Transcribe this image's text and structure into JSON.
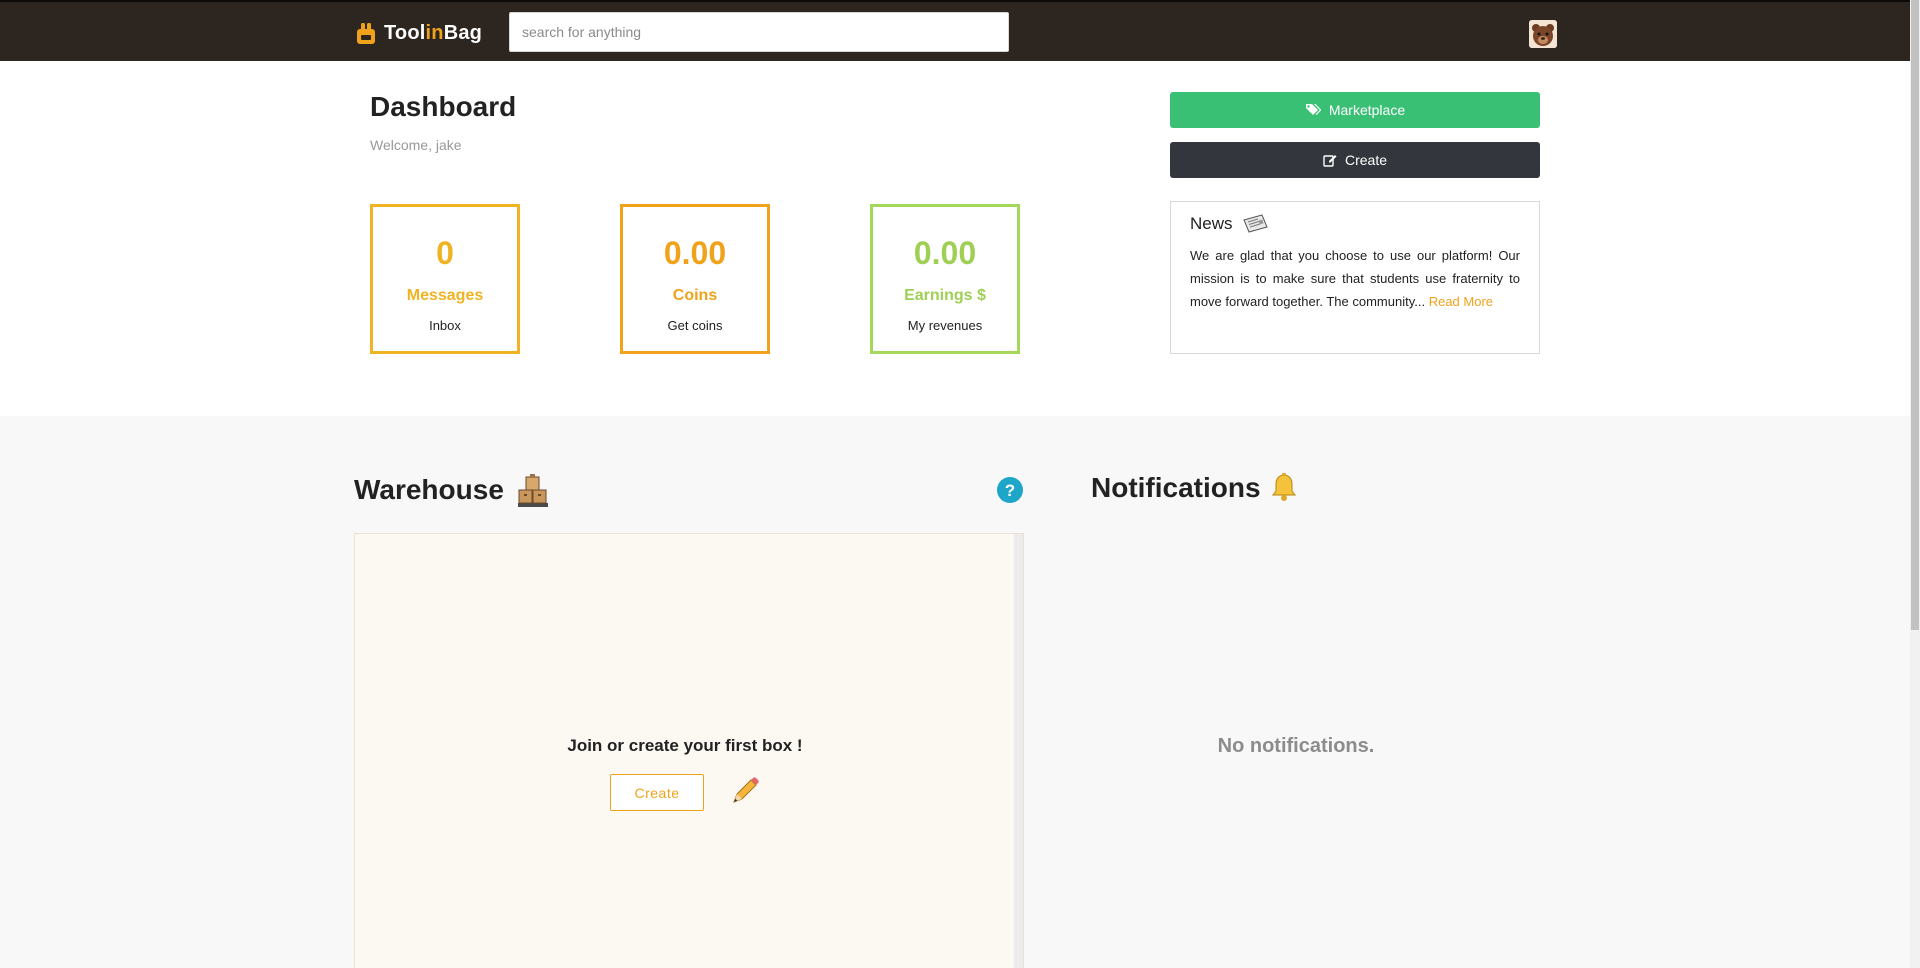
{
  "header": {
    "logo": {
      "part1": "Tool",
      "part2": "in",
      "part3": "Bag"
    },
    "search_placeholder": "search for anything"
  },
  "dashboard": {
    "title": "Dashboard",
    "welcome": "Welcome, jake",
    "stats": [
      {
        "value": "0",
        "label": "Messages",
        "sub": "Inbox"
      },
      {
        "value": "0.00",
        "label": "Coins",
        "sub": "Get coins"
      },
      {
        "value": "0.00",
        "label": "Earnings $",
        "sub": "My revenues"
      }
    ]
  },
  "actions": {
    "marketplace": "Marketplace",
    "create": "Create"
  },
  "news": {
    "title": "News",
    "text": "We are glad that you choose to use our platform! Our mission is to make sure that students use fraternity to move forward together. The community...",
    "read_more": "Read More"
  },
  "warehouse": {
    "title": "Warehouse",
    "empty_message": "Join or create your first box !",
    "create_button": "Create"
  },
  "notifications": {
    "title": "Notifications",
    "empty_message": "No notifications."
  },
  "colors": {
    "header_bg": "#2d251f",
    "accent_orange": "#f0a21b",
    "accent_yellow": "#f0b323",
    "accent_green": "#9fcf55",
    "market_green": "#3ac074",
    "dark_button": "#33373d",
    "help_blue": "#1ea6c8"
  }
}
